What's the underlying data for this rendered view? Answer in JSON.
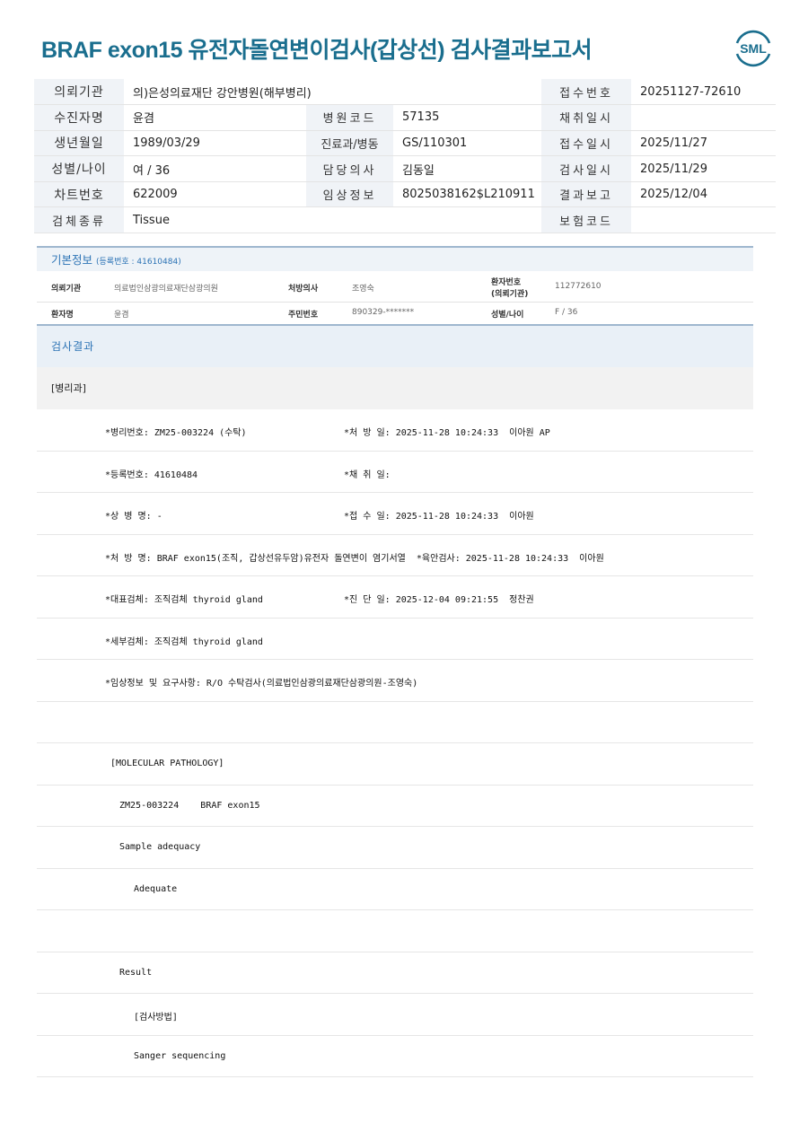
{
  "title": "BRAF exon15 유전자돌연변이검사(갑상선) 검사결과보고서",
  "logo_text": "SML",
  "info": {
    "r1": {
      "l1": "의뢰기관",
      "v1": "의)은성의료재단 강안병원(해부병리)",
      "l3": "접수번호",
      "v3": "20251127-72610"
    },
    "r2": {
      "l1": "수진자명",
      "v1": "윤겸",
      "l2": "병원코드",
      "v2": "57135",
      "l3": "채취일시",
      "v3": ""
    },
    "r3": {
      "l1": "생년월일",
      "v1": "1989/03/29",
      "l2": "진료과/병동",
      "v2": "GS/110301",
      "l3": "접수일시",
      "v3": "2025/11/27"
    },
    "r4": {
      "l1": "성별/나이",
      "v1": "여 / 36",
      "l2": "담당의사",
      "v2": "김동일",
      "l3": "검사일시",
      "v3": "2025/11/29"
    },
    "r5": {
      "l1": "차트번호",
      "v1": "622009",
      "l2": "임상정보",
      "v2": "8025038162$L210911",
      "l3": "결과보고",
      "v3": "2025/12/04"
    },
    "r6": {
      "l1": "검체종류",
      "v1": "Tissue",
      "l3": "보험코드",
      "v3": ""
    }
  },
  "basic": {
    "title": "기본정보",
    "sub": "(등록번호 : 41610484)",
    "k1": "의뢰기관",
    "v1": "의료법인삼광의료재단삼광의원",
    "k2": "처방의사",
    "v2": "조영숙",
    "k3a": "환자번호",
    "k3b": "(의뢰기관)",
    "v3": "112772610",
    "k4": "환자명",
    "v4": "윤겸",
    "k5": "주민번호",
    "v5": "890329-*******",
    "k6": "성별/나이",
    "v6": "F / 36"
  },
  "result_title": "검사결과",
  "dept": "[병리과]",
  "lines": [
    {
      "a": "*병리번호: ZM25-003224 (수탁)",
      "b": "*처 방 일: 2025-11-28 10:24:33  이아원 AP"
    },
    {
      "a": "*등록번호: 41610484",
      "b": "*채 취 일:"
    },
    {
      "a": "*상 병 명: -",
      "b": "*접 수 일: 2025-11-28 10:24:33  이아원"
    },
    {
      "a": "*처 방 명: BRAF exon15(조직, 갑상선유두암)유전자 돌연변이 염기서열  *육안검사: 2025-11-28 10:24:33  이아원",
      "b": ""
    },
    {
      "a": "*대표검체: 조직검체 thyroid gland",
      "b": "*진 단 일: 2025-12-04 09:21:55  정찬권"
    },
    {
      "a": "*세부검체: 조직검체 thyroid gland",
      "b": ""
    },
    {
      "a": "*임상정보 및 요구사항: R/O 수탁검사(의료법인삼광의료재단삼광의원-조영숙)",
      "b": ""
    },
    {
      "a": "",
      "b": ""
    },
    {
      "a": "[MOLECULAR PATHOLOGY]",
      "b": ""
    },
    {
      "a": "ZM25-003224    BRAF exon15",
      "b": ""
    },
    {
      "a": "Sample adequacy",
      "b": ""
    },
    {
      "a": "Adequate",
      "b": ""
    },
    {
      "a": "",
      "b": ""
    },
    {
      "a": "Result",
      "b": ""
    },
    {
      "a": "[검사방법]",
      "b": ""
    },
    {
      "a": "Sanger sequencing",
      "b": ""
    }
  ]
}
